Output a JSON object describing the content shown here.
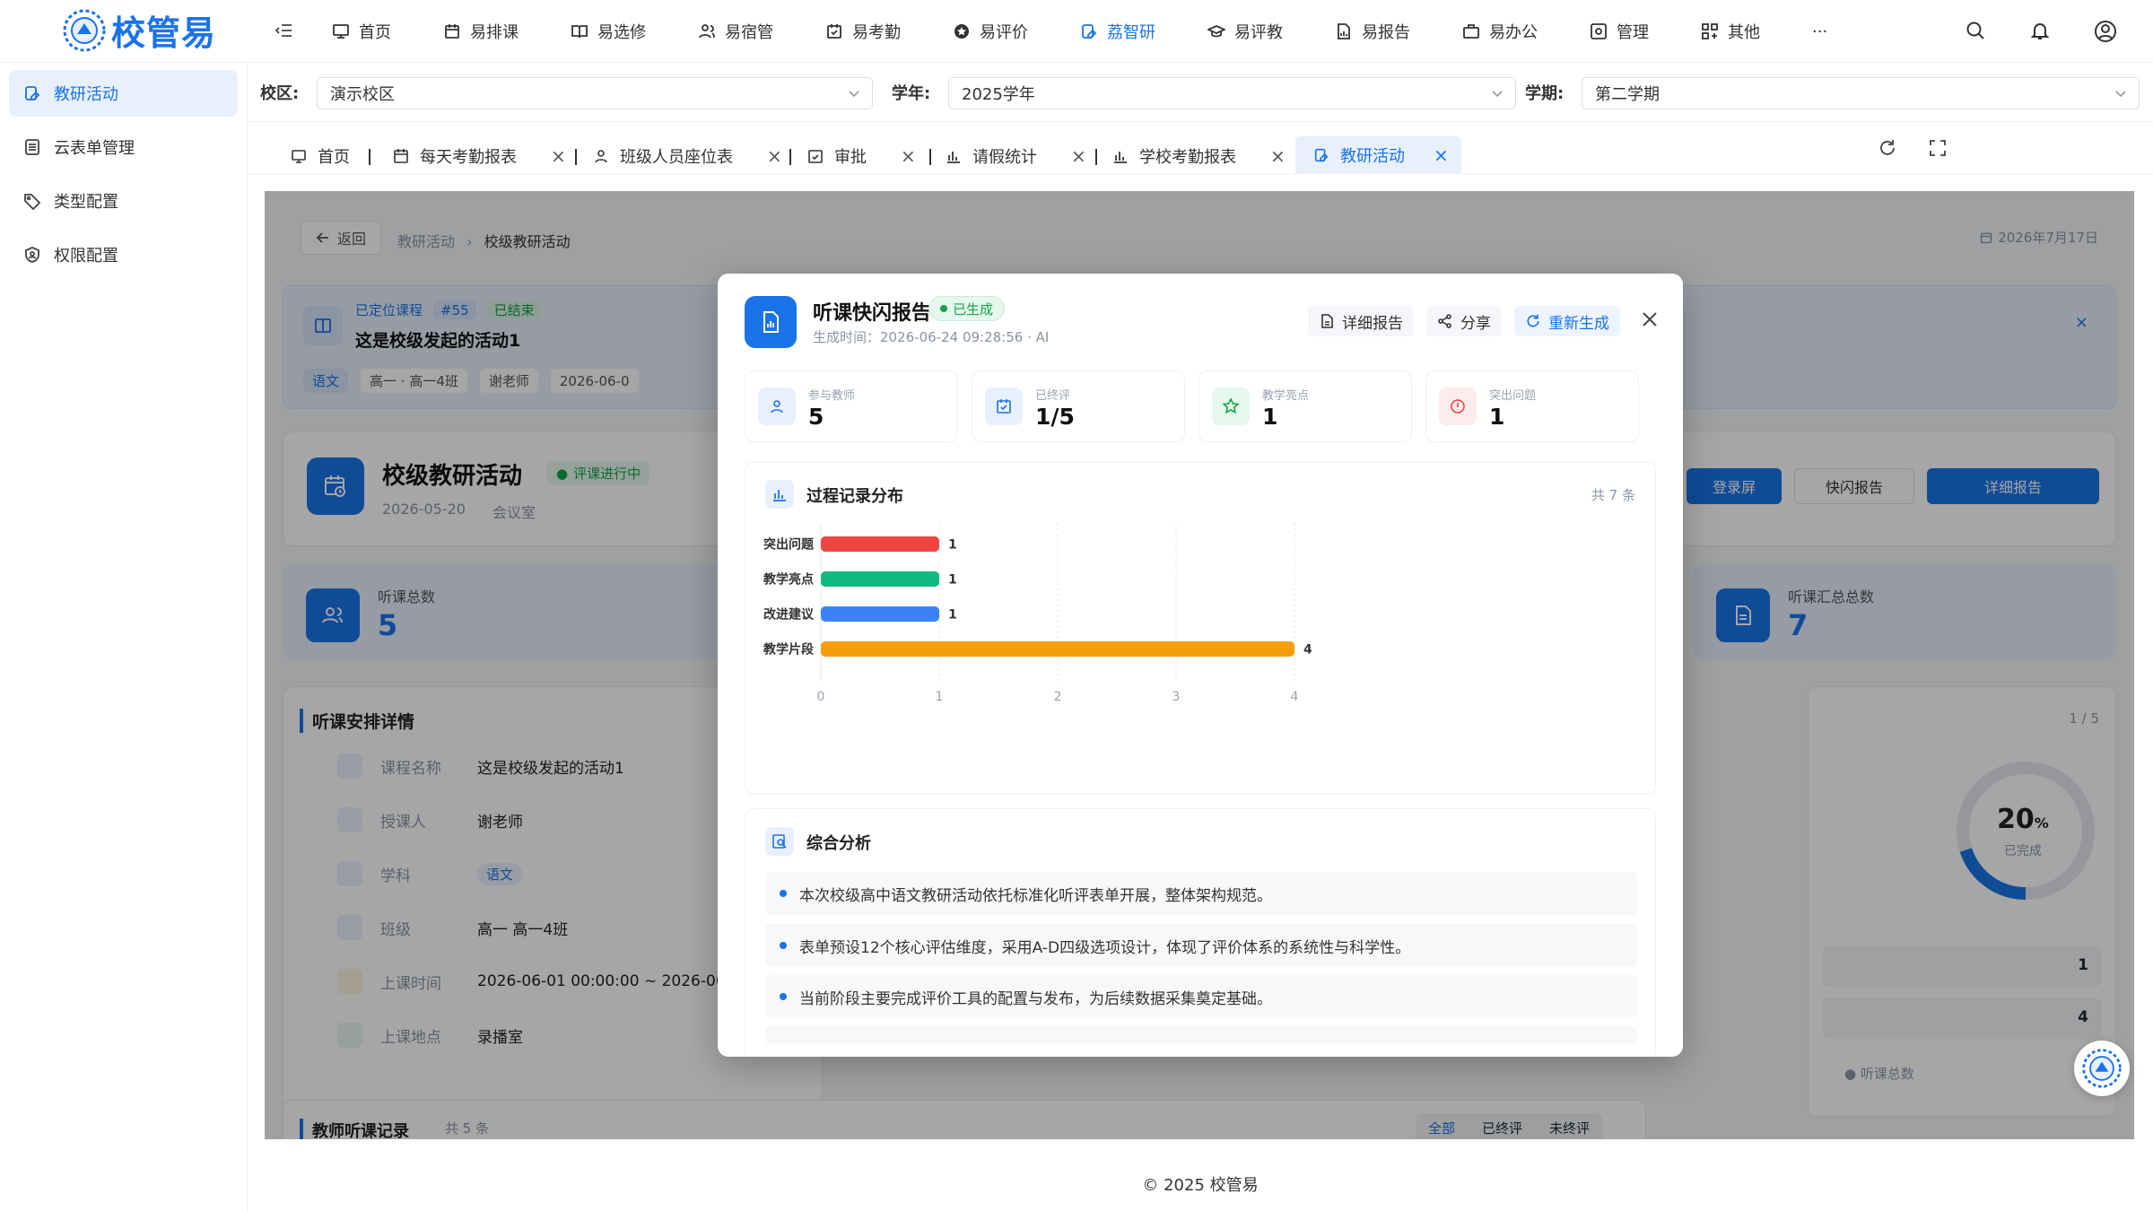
{
  "app": {
    "logo_text": "校管易",
    "brand_color": "#1a73e8"
  },
  "topnav": [
    {
      "label": "首页",
      "icon": "monitor-icon"
    },
    {
      "label": "易排课",
      "icon": "calendar-icon"
    },
    {
      "label": "易选修",
      "icon": "book-icon"
    },
    {
      "label": "易宿管",
      "icon": "users-icon"
    },
    {
      "label": "易考勤",
      "icon": "calendar-check-icon"
    },
    {
      "label": "易评价",
      "icon": "star-icon"
    },
    {
      "label": "荔智研",
      "icon": "clipboard-icon",
      "active": true
    },
    {
      "label": "易评教",
      "icon": "graduation-cap-icon"
    },
    {
      "label": "易报告",
      "icon": "file-chart-icon"
    },
    {
      "label": "易办公",
      "icon": "briefcase-icon"
    },
    {
      "label": "管理",
      "icon": "settings-box-icon"
    },
    {
      "label": "其他",
      "icon": "grid-icon"
    },
    {
      "label": "···",
      "icon": ""
    }
  ],
  "sidebar": {
    "items": [
      {
        "label": "教研活动",
        "icon": "clipboard-icon",
        "active": true
      },
      {
        "label": "云表单管理",
        "icon": "form-icon"
      },
      {
        "label": "类型配置",
        "icon": "tag-icon"
      },
      {
        "label": "权限配置",
        "icon": "shield-user-icon"
      }
    ]
  },
  "filters": {
    "campus_label": "校区:",
    "campus_value": "演示校区",
    "year_label": "学年:",
    "year_value": "2025学年",
    "term_label": "学期:",
    "term_value": "第二学期"
  },
  "tabs": [
    {
      "label": "首页",
      "closable": false
    },
    {
      "label": "每天考勤报表",
      "closable": true
    },
    {
      "label": "班级人员座位表",
      "closable": true
    },
    {
      "label": "审批",
      "closable": true
    },
    {
      "label": "请假统计",
      "closable": true
    },
    {
      "label": "学校考勤报表",
      "closable": true
    },
    {
      "label": "教研活动",
      "closable": true,
      "active": true
    }
  ],
  "tab_close": "×",
  "background": {
    "back_label": "返回",
    "crumb_parent": "教研活动",
    "crumb_current": "校级教研活动",
    "date": "2026年7月17日",
    "course_tag": "已定位课程",
    "course_id": "#55",
    "course_status": "已结束",
    "course_title": "这是校级发起的活动1",
    "course_subject": "语文",
    "course_class": "高一 · 高一4班",
    "course_teacher": "谢老师",
    "course_time": "2026-06-0",
    "activity_title": "校级教研活动",
    "activity_status": "评课进行中",
    "activity_date": "2026-05-20",
    "activity_place": "会议室",
    "btn_screen": "登录屏",
    "btn_flash": "快闪报告",
    "btn_detail": "详细报告",
    "stat_left_label": "听课总数",
    "stat_left_value": "5",
    "stat_right_label": "听课汇总总数",
    "stat_right_value": "7",
    "section_title": "听课安排详情",
    "details": [
      {
        "k": "课程名称",
        "v": "这是校级发起的活动1"
      },
      {
        "k": "授课人",
        "v": "谢老师"
      },
      {
        "k": "学科",
        "v": "语文"
      },
      {
        "k": "班级",
        "v": "高一 高一4班"
      },
      {
        "k": "上课时间",
        "v": "2026-06-01 00:00:00 ~ 2026-06-0"
      },
      {
        "k": "上课地点",
        "v": "录播室"
      }
    ],
    "right_count": "1 / 5",
    "donut_value": "20",
    "donut_pct": "%",
    "donut_label": "已完成",
    "donut_fraction": 0.2,
    "right_row1": "1",
    "right_row2": "4",
    "right_legend": "听课总数",
    "records_title": "教师听课记录",
    "records_count": "共 5 条",
    "records_tabs": [
      "全部",
      "已终评",
      "未终评"
    ]
  },
  "modal": {
    "title": "听课快闪报告",
    "status": "已生成",
    "subtitle": "生成时间：2026-06-24 09:28:56 · AI",
    "btn_detail": "详细报告",
    "btn_share": "分享",
    "btn_regen": "重新生成",
    "stats": [
      {
        "label": "参与教师",
        "value": "5",
        "icon": "users-icon",
        "color": "#1a73e8",
        "bg": "#e8f0fe"
      },
      {
        "label": "已终评",
        "value": "1/5",
        "icon": "calendar-check-icon",
        "color": "#1a73e8",
        "bg": "#e8f0fe"
      },
      {
        "label": "教学亮点",
        "value": "1",
        "icon": "star-icon",
        "color": "#16a34a",
        "bg": "#e6f7ee"
      },
      {
        "label": "突出问题",
        "value": "1",
        "icon": "alert-circle-icon",
        "color": "#ef4444",
        "bg": "#fdecec"
      }
    ],
    "chart_panel_title": "过程记录分布",
    "chart_panel_count": "共 7 条",
    "analysis_title": "综合分析",
    "analysis": [
      "本次校级高中语文教研活动依托标准化听评表单开展，整体架构规范。",
      "表单预设12个核心评估维度，采用A-D四级选项设计，体现了评价体系的系统性与科学性。",
      "当前阶段主要完成评价工具的配置与发布，为后续数据采集奠定基础。"
    ]
  },
  "chart_data": {
    "type": "bar",
    "orientation": "horizontal",
    "categories": [
      "突出问题",
      "教学亮点",
      "改进建议",
      "教学片段"
    ],
    "values": [
      1,
      1,
      1,
      4
    ],
    "colors": [
      "#ef4444",
      "#10b981",
      "#3b82f6",
      "#f59e0b"
    ],
    "xlim": [
      0,
      4
    ],
    "xticks": [
      0,
      1,
      2,
      3,
      4
    ],
    "grid": true,
    "data_labels": true
  },
  "footer": "© 2025 校管易"
}
